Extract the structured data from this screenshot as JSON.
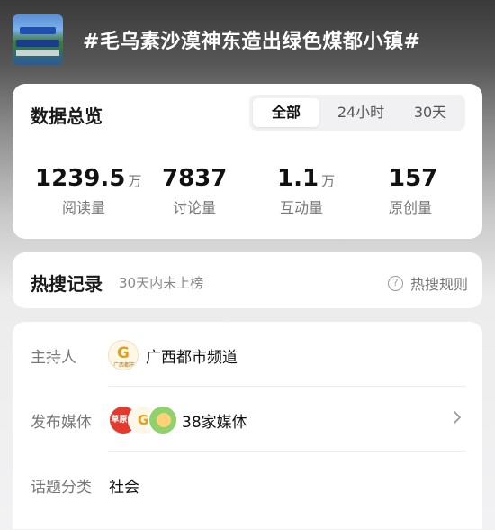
{
  "topic": {
    "title": "#毛乌素沙漠神东造出绿色煤都小镇#"
  },
  "overview": {
    "title": "数据总览",
    "tabs": [
      "全部",
      "24小时",
      "30天"
    ],
    "active_tab": "全部",
    "stats": [
      {
        "value": "1239.5",
        "unit": "万",
        "label": "阅读量"
      },
      {
        "value": "7837",
        "unit": "",
        "label": "讨论量"
      },
      {
        "value": "1.1",
        "unit": "万",
        "label": "互动量"
      },
      {
        "value": "157",
        "unit": "",
        "label": "原创量"
      }
    ]
  },
  "hot_search": {
    "title": "热搜记录",
    "subtitle": "30天内未上榜",
    "rule_label": "热搜规则"
  },
  "details": {
    "host": {
      "label": "主持人",
      "value": "广西都市频道"
    },
    "media": {
      "label": "发布媒体",
      "value": "38家媒体"
    },
    "category": {
      "label": "话题分类",
      "value": "社会"
    }
  },
  "colors": {
    "accent_red": "#e23b2e",
    "text_primary": "#111111",
    "text_secondary": "#777777"
  }
}
